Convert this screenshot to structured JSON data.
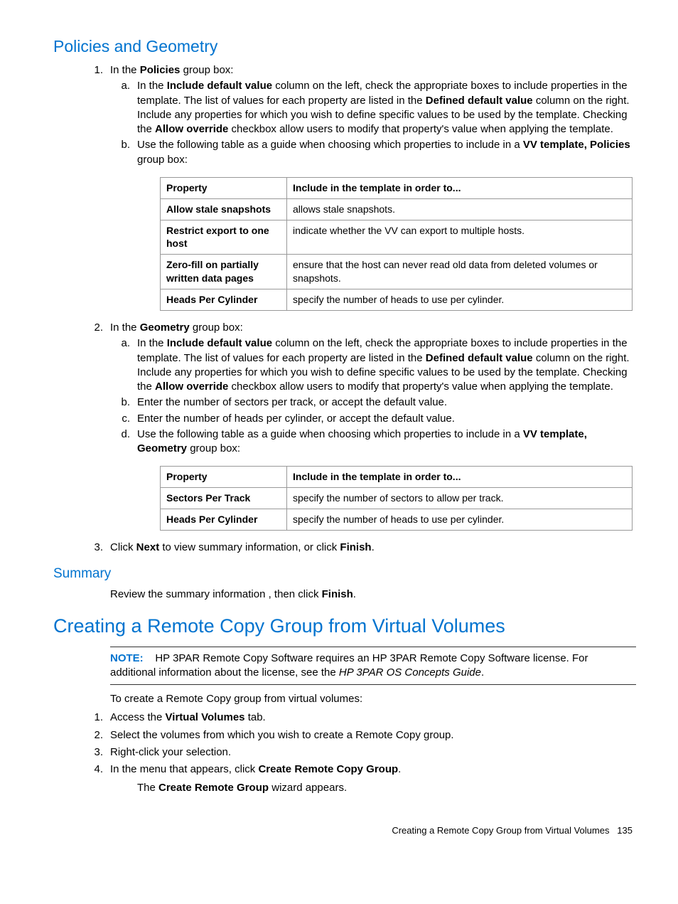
{
  "headings": {
    "policies_geometry": "Policies and Geometry",
    "summary": "Summary",
    "remote_copy": "Creating a Remote Copy Group from Virtual Volumes"
  },
  "pg": {
    "step1_intro_pre": "In the ",
    "step1_intro_b": "Policies",
    "step1_intro_post": " group box:",
    "step1a_p1": "In the ",
    "step1a_b1": "Include default value",
    "step1a_p2": " column on the left, check the appropriate boxes to include properties in the template. The list of values for each property are listed in the ",
    "step1a_b2": "Defined default value",
    "step1a_p3": " column on the right. Include any properties for which you wish to define specific values to be used by the template. Checking the ",
    "step1a_b3": "Allow override",
    "step1a_p4": " checkbox allow users to modify that property's value when applying the template.",
    "step1b_p1": "Use the following table as a guide when choosing which properties to include in a ",
    "step1b_b1": "VV template, Policies",
    "step1b_p2": " group box:",
    "step2_intro_pre": "In the ",
    "step2_intro_b": "Geometry",
    "step2_intro_post": " group box:",
    "step2b": "Enter the number of sectors per track, or accept the default value.",
    "step2c": "Enter the number of heads per cylinder, or accept the default value.",
    "step2d_p1": "Use the following table as a guide when choosing which properties to include in a ",
    "step2d_b1": "VV template, Geometry",
    "step2d_p2": " group box:",
    "step3_p1": "Click ",
    "step3_b1": "Next",
    "step3_p2": " to view summary information, or click ",
    "step3_b2": "Finish",
    "step3_p3": "."
  },
  "table1": {
    "h1": "Property",
    "h2": "Include in the template in order to...",
    "r1c1": "Allow stale snapshots",
    "r1c2": "allows stale snapshots.",
    "r2c1": "Restrict export to one host",
    "r2c2": "indicate whether the VV can export to multiple hosts.",
    "r3c1": "Zero-fill on partially written data pages",
    "r3c2": "ensure that the host can never read old data from deleted volumes or snapshots.",
    "r4c1": "Heads Per Cylinder",
    "r4c2": "specify the number of heads to use per cylinder."
  },
  "table2": {
    "h1": "Property",
    "h2": "Include in the template in order to...",
    "r1c1": "Sectors Per Track",
    "r1c2": "specify the number of sectors to allow per track.",
    "r2c1": "Heads Per Cylinder",
    "r2c2": "specify the number of heads to use per cylinder."
  },
  "summary": {
    "p1": "Review the summary information , then click ",
    "b1": "Finish",
    "p2": "."
  },
  "rc": {
    "note_label": "NOTE:",
    "note_p1": "HP 3PAR Remote Copy Software requires an HP 3PAR Remote Copy Software license. For additional information about the license, see the ",
    "note_it": "HP 3PAR OS Concepts Guide",
    "note_p2": ".",
    "intro": "To create a Remote Copy group from virtual volumes:",
    "s1_p1": "Access the ",
    "s1_b1": "Virtual Volumes",
    "s1_p2": " tab.",
    "s2": "Select the volumes from which you wish to create a Remote Copy group.",
    "s3": "Right-click your selection.",
    "s4_p1": "In the menu that appears, click ",
    "s4_b1": "Create Remote Copy Group",
    "s4_p2": ".",
    "s4_cont_p1": "The ",
    "s4_cont_b1": "Create Remote Group",
    "s4_cont_p2": " wizard appears."
  },
  "footer": {
    "text": "Creating a Remote Copy Group from Virtual Volumes",
    "page": "135"
  }
}
